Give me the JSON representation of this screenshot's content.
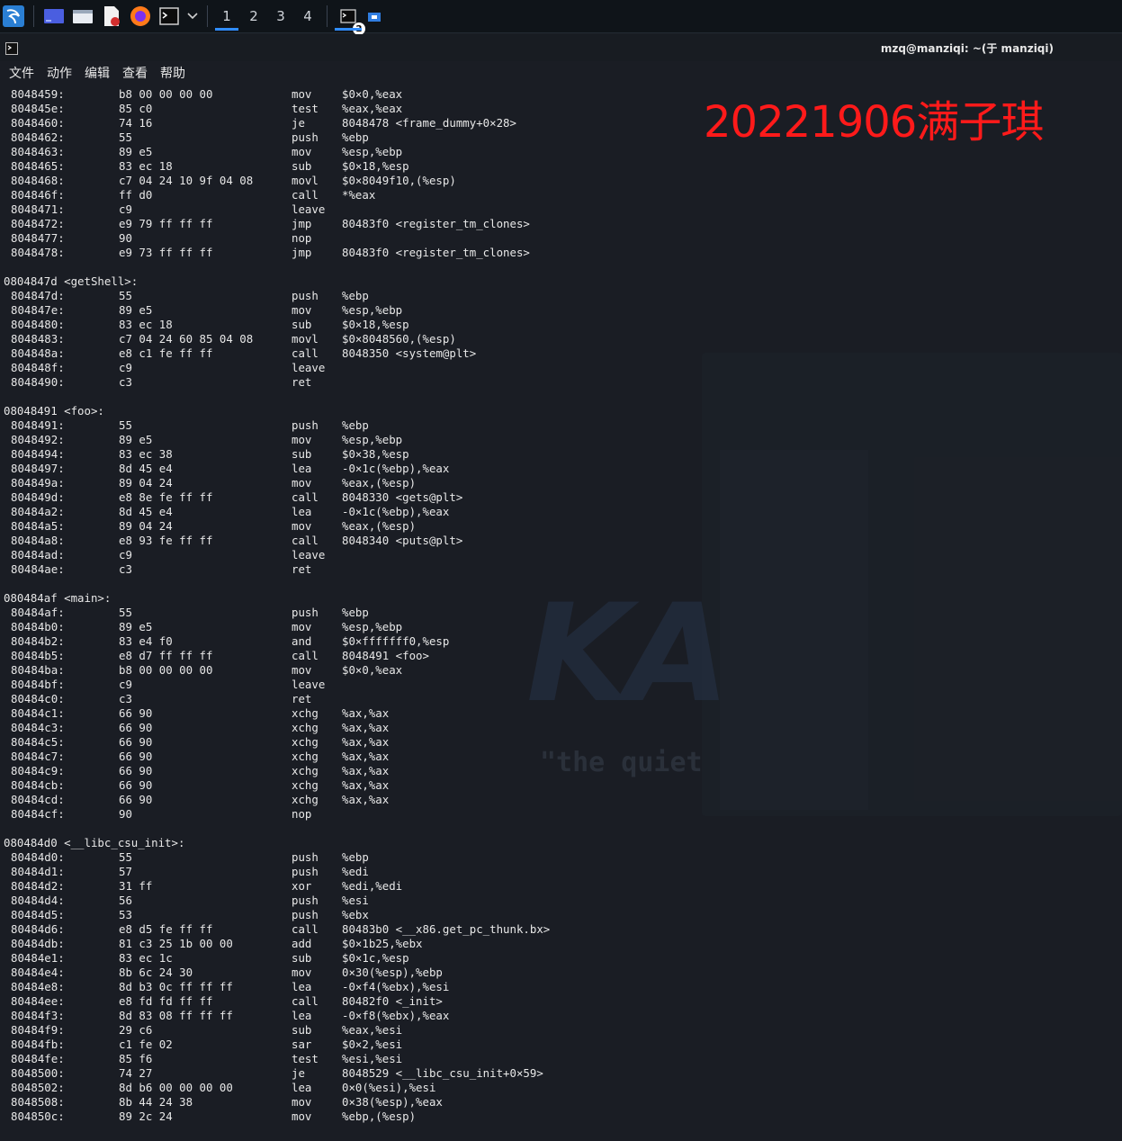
{
  "taskbar": {
    "workspaces": [
      "1",
      "2",
      "3",
      "4"
    ],
    "active_workspace": "1",
    "terminal_badge": "2"
  },
  "window": {
    "title": "mzq@manziqi: ~(于 manziqi)"
  },
  "menu": [
    "文件",
    "动作",
    "编辑",
    "查看",
    "帮助"
  ],
  "watermark": "20221906满子琪",
  "background": {
    "logo_text": "KA",
    "slogan": "\"the quiet"
  },
  "disassembly": [
    {
      "addr": "8048459:",
      "bytes": "b8 00 00 00 00",
      "mnemonic": "mov",
      "operands": "$0×0,%eax"
    },
    {
      "addr": "804845e:",
      "bytes": "85 c0",
      "mnemonic": "test",
      "operands": "%eax,%eax"
    },
    {
      "addr": "8048460:",
      "bytes": "74 16",
      "mnemonic": "je",
      "operands": "8048478 <frame_dummy+0×28>"
    },
    {
      "addr": "8048462:",
      "bytes": "55",
      "mnemonic": "push",
      "operands": "%ebp"
    },
    {
      "addr": "8048463:",
      "bytes": "89 e5",
      "mnemonic": "mov",
      "operands": "%esp,%ebp"
    },
    {
      "addr": "8048465:",
      "bytes": "83 ec 18",
      "mnemonic": "sub",
      "operands": "$0×18,%esp"
    },
    {
      "addr": "8048468:",
      "bytes": "c7 04 24 10 9f 04 08",
      "mnemonic": "movl",
      "operands": "$0×8049f10,(%esp)"
    },
    {
      "addr": "804846f:",
      "bytes": "ff d0",
      "mnemonic": "call",
      "operands": "*%eax"
    },
    {
      "addr": "8048471:",
      "bytes": "c9",
      "mnemonic": "leave",
      "operands": ""
    },
    {
      "addr": "8048472:",
      "bytes": "e9 79 ff ff ff",
      "mnemonic": "jmp",
      "operands": "80483f0 <register_tm_clones>"
    },
    {
      "addr": "8048477:",
      "bytes": "90",
      "mnemonic": "nop",
      "operands": ""
    },
    {
      "addr": "8048478:",
      "bytes": "e9 73 ff ff ff",
      "mnemonic": "jmp",
      "operands": "80483f0 <register_tm_clones>"
    },
    {
      "blank": true
    },
    {
      "header": "0804847d <getShell>:"
    },
    {
      "addr": "804847d:",
      "bytes": "55",
      "mnemonic": "push",
      "operands": "%ebp"
    },
    {
      "addr": "804847e:",
      "bytes": "89 e5",
      "mnemonic": "mov",
      "operands": "%esp,%ebp"
    },
    {
      "addr": "8048480:",
      "bytes": "83 ec 18",
      "mnemonic": "sub",
      "operands": "$0×18,%esp"
    },
    {
      "addr": "8048483:",
      "bytes": "c7 04 24 60 85 04 08",
      "mnemonic": "movl",
      "operands": "$0×8048560,(%esp)"
    },
    {
      "addr": "804848a:",
      "bytes": "e8 c1 fe ff ff",
      "mnemonic": "call",
      "operands": "8048350 <system@plt>"
    },
    {
      "addr": "804848f:",
      "bytes": "c9",
      "mnemonic": "leave",
      "operands": ""
    },
    {
      "addr": "8048490:",
      "bytes": "c3",
      "mnemonic": "ret",
      "operands": ""
    },
    {
      "blank": true
    },
    {
      "header": "08048491 <foo>:"
    },
    {
      "addr": "8048491:",
      "bytes": "55",
      "mnemonic": "push",
      "operands": "%ebp"
    },
    {
      "addr": "8048492:",
      "bytes": "89 e5",
      "mnemonic": "mov",
      "operands": "%esp,%ebp"
    },
    {
      "addr": "8048494:",
      "bytes": "83 ec 38",
      "mnemonic": "sub",
      "operands": "$0×38,%esp"
    },
    {
      "addr": "8048497:",
      "bytes": "8d 45 e4",
      "mnemonic": "lea",
      "operands": "-0×1c(%ebp),%eax"
    },
    {
      "addr": "804849a:",
      "bytes": "89 04 24",
      "mnemonic": "mov",
      "operands": "%eax,(%esp)"
    },
    {
      "addr": "804849d:",
      "bytes": "e8 8e fe ff ff",
      "mnemonic": "call",
      "operands": "8048330 <gets@plt>"
    },
    {
      "addr": "80484a2:",
      "bytes": "8d 45 e4",
      "mnemonic": "lea",
      "operands": "-0×1c(%ebp),%eax"
    },
    {
      "addr": "80484a5:",
      "bytes": "89 04 24",
      "mnemonic": "mov",
      "operands": "%eax,(%esp)"
    },
    {
      "addr": "80484a8:",
      "bytes": "e8 93 fe ff ff",
      "mnemonic": "call",
      "operands": "8048340 <puts@plt>"
    },
    {
      "addr": "80484ad:",
      "bytes": "c9",
      "mnemonic": "leave",
      "operands": ""
    },
    {
      "addr": "80484ae:",
      "bytes": "c3",
      "mnemonic": "ret",
      "operands": ""
    },
    {
      "blank": true
    },
    {
      "header": "080484af <main>:"
    },
    {
      "addr": "80484af:",
      "bytes": "55",
      "mnemonic": "push",
      "operands": "%ebp"
    },
    {
      "addr": "80484b0:",
      "bytes": "89 e5",
      "mnemonic": "mov",
      "operands": "%esp,%ebp"
    },
    {
      "addr": "80484b2:",
      "bytes": "83 e4 f0",
      "mnemonic": "and",
      "operands": "$0×fffffff0,%esp"
    },
    {
      "addr": "80484b5:",
      "bytes": "e8 d7 ff ff ff",
      "mnemonic": "call",
      "operands": "8048491 <foo>"
    },
    {
      "addr": "80484ba:",
      "bytes": "b8 00 00 00 00",
      "mnemonic": "mov",
      "operands": "$0×0,%eax"
    },
    {
      "addr": "80484bf:",
      "bytes": "c9",
      "mnemonic": "leave",
      "operands": ""
    },
    {
      "addr": "80484c0:",
      "bytes": "c3",
      "mnemonic": "ret",
      "operands": ""
    },
    {
      "addr": "80484c1:",
      "bytes": "66 90",
      "mnemonic": "xchg",
      "operands": "%ax,%ax"
    },
    {
      "addr": "80484c3:",
      "bytes": "66 90",
      "mnemonic": "xchg",
      "operands": "%ax,%ax"
    },
    {
      "addr": "80484c5:",
      "bytes": "66 90",
      "mnemonic": "xchg",
      "operands": "%ax,%ax"
    },
    {
      "addr": "80484c7:",
      "bytes": "66 90",
      "mnemonic": "xchg",
      "operands": "%ax,%ax"
    },
    {
      "addr": "80484c9:",
      "bytes": "66 90",
      "mnemonic": "xchg",
      "operands": "%ax,%ax"
    },
    {
      "addr": "80484cb:",
      "bytes": "66 90",
      "mnemonic": "xchg",
      "operands": "%ax,%ax"
    },
    {
      "addr": "80484cd:",
      "bytes": "66 90",
      "mnemonic": "xchg",
      "operands": "%ax,%ax"
    },
    {
      "addr": "80484cf:",
      "bytes": "90",
      "mnemonic": "nop",
      "operands": ""
    },
    {
      "blank": true
    },
    {
      "header": "080484d0 <__libc_csu_init>:"
    },
    {
      "addr": "80484d0:",
      "bytes": "55",
      "mnemonic": "push",
      "operands": "%ebp"
    },
    {
      "addr": "80484d1:",
      "bytes": "57",
      "mnemonic": "push",
      "operands": "%edi"
    },
    {
      "addr": "80484d2:",
      "bytes": "31 ff",
      "mnemonic": "xor",
      "operands": "%edi,%edi"
    },
    {
      "addr": "80484d4:",
      "bytes": "56",
      "mnemonic": "push",
      "operands": "%esi"
    },
    {
      "addr": "80484d5:",
      "bytes": "53",
      "mnemonic": "push",
      "operands": "%ebx"
    },
    {
      "addr": "80484d6:",
      "bytes": "e8 d5 fe ff ff",
      "mnemonic": "call",
      "operands": "80483b0 <__x86.get_pc_thunk.bx>"
    },
    {
      "addr": "80484db:",
      "bytes": "81 c3 25 1b 00 00",
      "mnemonic": "add",
      "operands": "$0×1b25,%ebx"
    },
    {
      "addr": "80484e1:",
      "bytes": "83 ec 1c",
      "mnemonic": "sub",
      "operands": "$0×1c,%esp"
    },
    {
      "addr": "80484e4:",
      "bytes": "8b 6c 24 30",
      "mnemonic": "mov",
      "operands": "0×30(%esp),%ebp"
    },
    {
      "addr": "80484e8:",
      "bytes": "8d b3 0c ff ff ff",
      "mnemonic": "lea",
      "operands": "-0×f4(%ebx),%esi"
    },
    {
      "addr": "80484ee:",
      "bytes": "e8 fd fd ff ff",
      "mnemonic": "call",
      "operands": "80482f0 <_init>"
    },
    {
      "addr": "80484f3:",
      "bytes": "8d 83 08 ff ff ff",
      "mnemonic": "lea",
      "operands": "-0×f8(%ebx),%eax"
    },
    {
      "addr": "80484f9:",
      "bytes": "29 c6",
      "mnemonic": "sub",
      "operands": "%eax,%esi"
    },
    {
      "addr": "80484fb:",
      "bytes": "c1 fe 02",
      "mnemonic": "sar",
      "operands": "$0×2,%esi"
    },
    {
      "addr": "80484fe:",
      "bytes": "85 f6",
      "mnemonic": "test",
      "operands": "%esi,%esi"
    },
    {
      "addr": "8048500:",
      "bytes": "74 27",
      "mnemonic": "je",
      "operands": "8048529 <__libc_csu_init+0×59>"
    },
    {
      "addr": "8048502:",
      "bytes": "8d b6 00 00 00 00",
      "mnemonic": "lea",
      "operands": "0×0(%esi),%esi"
    },
    {
      "addr": "8048508:",
      "bytes": "8b 44 24 38",
      "mnemonic": "mov",
      "operands": "0×38(%esp),%eax"
    },
    {
      "addr": "804850c:",
      "bytes": "89 2c 24",
      "mnemonic": "mov",
      "operands": "%ebp,(%esp)"
    }
  ]
}
